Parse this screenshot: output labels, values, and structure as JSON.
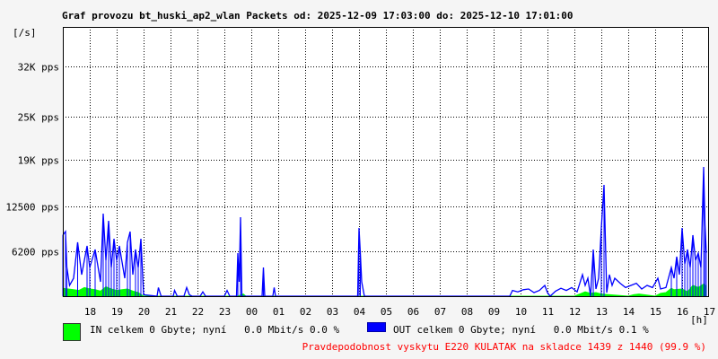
{
  "title": "Graf provozu bt_huski_ap2_wlan Packets od: 2025-12-09 17:03:00 do: 2025-12-10 17:01:00",
  "chart_data": {
    "type": "area",
    "y_unit_label": "[/s]",
    "x_unit_label": "[h]",
    "y_ticks": [
      {
        "value": 6200,
        "label": "6200 pps"
      },
      {
        "value": 12500,
        "label": "12500 pps"
      },
      {
        "value": 19000,
        "label": "19K pps"
      },
      {
        "value": 25000,
        "label": "25K pps"
      },
      {
        "value": 32000,
        "label": "32K pps"
      }
    ],
    "ylim": [
      0,
      37500
    ],
    "x_ticks": [
      "18",
      "19",
      "20",
      "21",
      "22",
      "23",
      "00",
      "01",
      "02",
      "03",
      "04",
      "05",
      "06",
      "07",
      "08",
      "09",
      "10",
      "11",
      "12",
      "13",
      "14",
      "15",
      "16",
      "17"
    ],
    "x_range_hours": [
      0,
      24
    ],
    "series": [
      {
        "name": "IN",
        "color": "#00ff00",
        "points": [
          [
            0.0,
            1100
          ],
          [
            0.2,
            1000
          ],
          [
            0.4,
            900
          ],
          [
            0.6,
            800
          ],
          [
            0.8,
            1200
          ],
          [
            1.0,
            1000
          ],
          [
            1.2,
            900
          ],
          [
            1.4,
            700
          ],
          [
            1.6,
            1300
          ],
          [
            1.8,
            1000
          ],
          [
            2.0,
            800
          ],
          [
            2.2,
            900
          ],
          [
            2.4,
            1000
          ],
          [
            2.6,
            700
          ],
          [
            2.8,
            500
          ],
          [
            3.0,
            0
          ],
          [
            6.5,
            0
          ],
          [
            6.7,
            300
          ],
          [
            6.8,
            0
          ],
          [
            19.0,
            0
          ],
          [
            19.2,
            300
          ],
          [
            19.4,
            600
          ],
          [
            19.6,
            400
          ],
          [
            19.8,
            500
          ],
          [
            20.0,
            300
          ],
          [
            21.0,
            0
          ],
          [
            21.2,
            200
          ],
          [
            21.4,
            300
          ],
          [
            22.0,
            0
          ],
          [
            22.2,
            400
          ],
          [
            22.4,
            500
          ],
          [
            22.6,
            1100
          ],
          [
            22.7,
            900
          ],
          [
            23.0,
            1000
          ],
          [
            23.2,
            600
          ],
          [
            23.4,
            1500
          ],
          [
            23.6,
            1200
          ],
          [
            23.8,
            1700
          ],
          [
            23.9,
            1400
          ]
        ]
      },
      {
        "name": "OUT",
        "color": "#0000ff",
        "points": [
          [
            0.0,
            8500
          ],
          [
            0.1,
            9000
          ],
          [
            0.15,
            4000
          ],
          [
            0.25,
            1500
          ],
          [
            0.4,
            2500
          ],
          [
            0.55,
            7500
          ],
          [
            0.7,
            3000
          ],
          [
            0.9,
            7000
          ],
          [
            1.0,
            4000
          ],
          [
            1.2,
            6500
          ],
          [
            1.4,
            2000
          ],
          [
            1.5,
            11500
          ],
          [
            1.6,
            5000
          ],
          [
            1.7,
            10500
          ],
          [
            1.8,
            4000
          ],
          [
            1.9,
            8000
          ],
          [
            2.0,
            5000
          ],
          [
            2.1,
            7000
          ],
          [
            2.3,
            2500
          ],
          [
            2.4,
            7500
          ],
          [
            2.5,
            9000
          ],
          [
            2.6,
            3000
          ],
          [
            2.7,
            6500
          ],
          [
            2.8,
            4000
          ],
          [
            2.9,
            8000
          ],
          [
            3.0,
            200
          ],
          [
            3.5,
            0
          ],
          [
            3.55,
            1200
          ],
          [
            3.65,
            0
          ],
          [
            4.1,
            0
          ],
          [
            4.15,
            800
          ],
          [
            4.25,
            0
          ],
          [
            4.5,
            0
          ],
          [
            4.6,
            1200
          ],
          [
            4.7,
            200
          ],
          [
            4.8,
            0
          ],
          [
            5.1,
            0
          ],
          [
            5.2,
            600
          ],
          [
            5.3,
            0
          ],
          [
            6.0,
            0
          ],
          [
            6.1,
            800
          ],
          [
            6.2,
            0
          ],
          [
            6.45,
            0
          ],
          [
            6.5,
            6000
          ],
          [
            6.55,
            2000
          ],
          [
            6.6,
            11000
          ],
          [
            6.65,
            0
          ],
          [
            7.4,
            0
          ],
          [
            7.45,
            4000
          ],
          [
            7.5,
            0
          ],
          [
            7.8,
            0
          ],
          [
            7.85,
            1200
          ],
          [
            7.9,
            0
          ],
          [
            10.95,
            0
          ],
          [
            11.0,
            9500
          ],
          [
            11.05,
            6000
          ],
          [
            11.1,
            2000
          ],
          [
            11.2,
            0
          ],
          [
            16.6,
            0
          ],
          [
            16.7,
            800
          ],
          [
            16.9,
            600
          ],
          [
            17.1,
            900
          ],
          [
            17.3,
            1000
          ],
          [
            17.5,
            500
          ],
          [
            17.7,
            800
          ],
          [
            17.9,
            1500
          ],
          [
            18.0,
            500
          ],
          [
            18.1,
            0
          ],
          [
            18.3,
            700
          ],
          [
            18.5,
            1100
          ],
          [
            18.7,
            800
          ],
          [
            18.9,
            1200
          ],
          [
            19.1,
            600
          ],
          [
            19.3,
            3000
          ],
          [
            19.4,
            1500
          ],
          [
            19.5,
            2500
          ],
          [
            19.6,
            0
          ],
          [
            19.7,
            6500
          ],
          [
            19.8,
            1000
          ],
          [
            19.9,
            2500
          ],
          [
            20.0,
            9500
          ],
          [
            20.1,
            15500
          ],
          [
            20.2,
            500
          ],
          [
            20.3,
            3000
          ],
          [
            20.4,
            1500
          ],
          [
            20.5,
            2500
          ],
          [
            20.7,
            1800
          ],
          [
            20.9,
            1200
          ],
          [
            21.1,
            1500
          ],
          [
            21.3,
            1800
          ],
          [
            21.5,
            1000
          ],
          [
            21.7,
            1500
          ],
          [
            21.9,
            1200
          ],
          [
            22.1,
            2500
          ],
          [
            22.2,
            1000
          ],
          [
            22.4,
            1200
          ],
          [
            22.6,
            4000
          ],
          [
            22.7,
            2500
          ],
          [
            22.8,
            5500
          ],
          [
            22.9,
            3000
          ],
          [
            23.0,
            9500
          ],
          [
            23.1,
            4500
          ],
          [
            23.2,
            6500
          ],
          [
            23.3,
            4000
          ],
          [
            23.4,
            8500
          ],
          [
            23.5,
            5000
          ],
          [
            23.6,
            6000
          ],
          [
            23.7,
            4000
          ],
          [
            23.8,
            18000
          ],
          [
            23.85,
            10000
          ],
          [
            23.9,
            6000
          ]
        ]
      }
    ],
    "legend": [
      {
        "key": "in",
        "text": "IN celkem 0 Gbyte; nyní   0.0 Mbit/s 0.0 %"
      },
      {
        "key": "out",
        "text": "OUT celkem 0 Gbyte; nyní   0.0 Mbit/s 0.1 %"
      }
    ]
  },
  "note": "Pravdepodobnost vyskytu E220 KULATAK na skladce 1439 z 1440 (99.9 %)"
}
